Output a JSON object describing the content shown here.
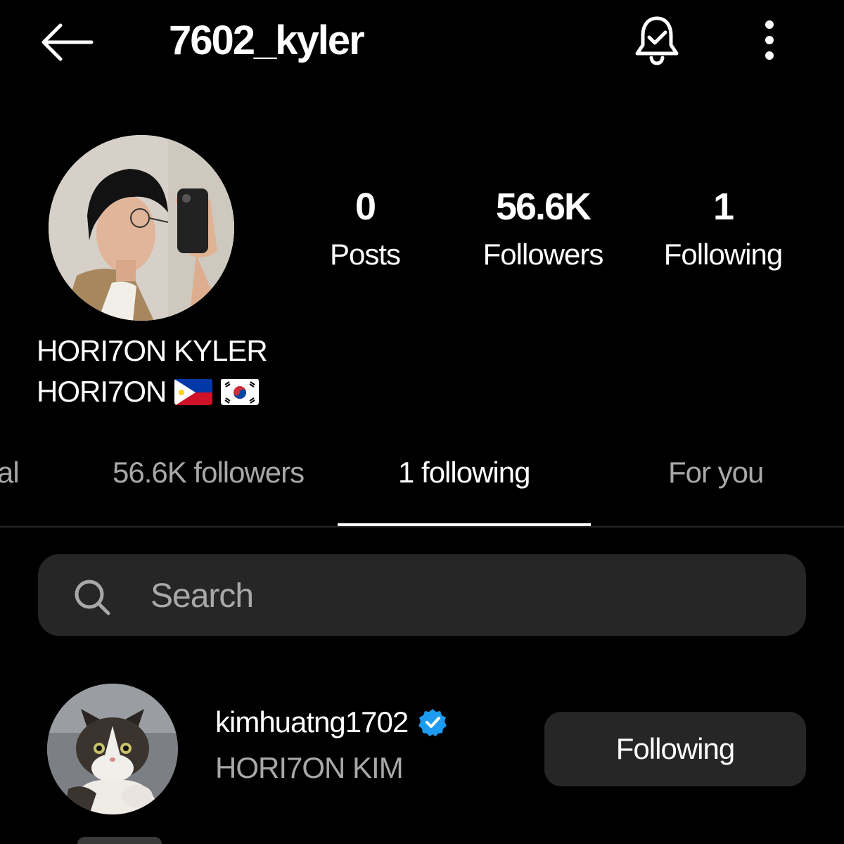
{
  "header": {
    "title": "7602_kyler",
    "back_icon": "arrow-left-icon",
    "notification_icon": "bell-check-icon",
    "more_icon": "more-vertical-icon"
  },
  "profile": {
    "stats": [
      {
        "value": "0",
        "label": "Posts"
      },
      {
        "value": "56.6K",
        "label": "Followers"
      },
      {
        "value": "1",
        "label": "Following"
      }
    ],
    "name": "HORI7ON KYLER",
    "bio_text": "HORI7ON",
    "bio_flags": [
      "philippines-flag-icon",
      "south-korea-flag-icon"
    ]
  },
  "tabs": [
    {
      "label": "al",
      "active": false
    },
    {
      "label": "56.6K followers",
      "active": false
    },
    {
      "label": "1 following",
      "active": true
    },
    {
      "label": "For you",
      "active": false
    }
  ],
  "search": {
    "placeholder": "Search",
    "value": ""
  },
  "following_list": [
    {
      "username": "kimhuatng1702",
      "verified": true,
      "full_name": "HORI7ON KIM",
      "button_label": "Following"
    }
  ],
  "colors": {
    "background": "#000000",
    "surface": "#262626",
    "muted_text": "#a8a8a8",
    "verified_blue": "#1d9bf0"
  }
}
